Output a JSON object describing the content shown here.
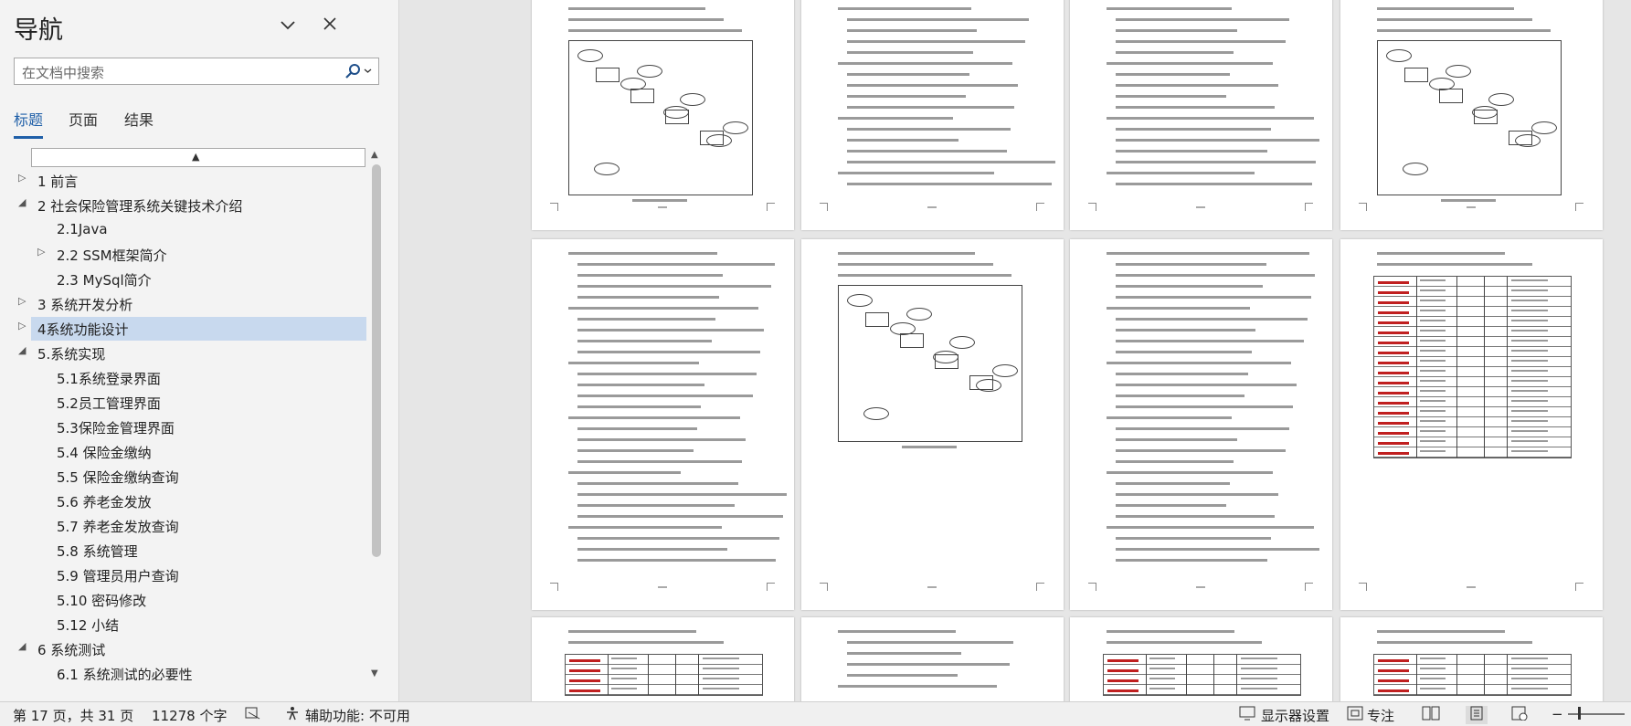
{
  "nav": {
    "title": "导航",
    "search_placeholder": "在文档中搜索",
    "tabs": [
      "标题",
      "页面",
      "结果"
    ],
    "tree": [
      {
        "label": "1 前言",
        "level": 1,
        "toggle": "collapsed"
      },
      {
        "label": "2 社会保险管理系统关键技术介绍",
        "level": 1,
        "toggle": "expanded"
      },
      {
        "label": "2.1Java",
        "level": 2,
        "toggle": "none"
      },
      {
        "label": "2.2 SSM框架简介",
        "level": 2,
        "toggle": "collapsed"
      },
      {
        "label": "2.3 MySql简介",
        "level": 2,
        "toggle": "none"
      },
      {
        "label": "3 系统开发分析",
        "level": 1,
        "toggle": "collapsed"
      },
      {
        "label": "4系统功能设计",
        "level": 1,
        "toggle": "collapsed",
        "selected": true
      },
      {
        "label": "5.系统实现",
        "level": 1,
        "toggle": "expanded"
      },
      {
        "label": "5.1系统登录界面",
        "level": 2,
        "toggle": "none"
      },
      {
        "label": "5.2员工管理界面",
        "level": 2,
        "toggle": "none"
      },
      {
        "label": "5.3保险金管理界面",
        "level": 2,
        "toggle": "none"
      },
      {
        "label": "5.4 保险金缴纳",
        "level": 2,
        "toggle": "none"
      },
      {
        "label": "5.5 保险金缴纳查询",
        "level": 2,
        "toggle": "none"
      },
      {
        "label": "5.6 养老金发放",
        "level": 2,
        "toggle": "none"
      },
      {
        "label": "5.7 养老金发放查询",
        "level": 2,
        "toggle": "none"
      },
      {
        "label": "5.8 系统管理",
        "level": 2,
        "toggle": "none"
      },
      {
        "label": "5.9 管理员用户查询",
        "level": 2,
        "toggle": "none"
      },
      {
        "label": "5.10 密码修改",
        "level": 2,
        "toggle": "none"
      },
      {
        "label": "5.12 小结",
        "level": 2,
        "toggle": "none"
      },
      {
        "label": "6 系统测试",
        "level": 1,
        "toggle": "expanded"
      },
      {
        "label": "6.1 系统测试的必要性",
        "level": 2,
        "toggle": "none"
      }
    ]
  },
  "status": {
    "page": "第 17 页，共 31 页",
    "words": "11278 个字",
    "accessibility": "辅助功能: 不可用",
    "display": "显示器设置",
    "focus": "专注"
  },
  "doc": {
    "page_texts": {
      "p2_lines": [
        "（1）数据表：",
        "1）名字：档案文件",
        "2）名字：员工号",
        "4）名字：退休员工账号"
      ],
      "p7_caption": "图 4.8 实体关系图",
      "p9_caption": "图 4.5 实体属性图",
      "table_cells": [
        "password",
        "varchar",
        "20",
        "管理员密码"
      ]
    }
  }
}
